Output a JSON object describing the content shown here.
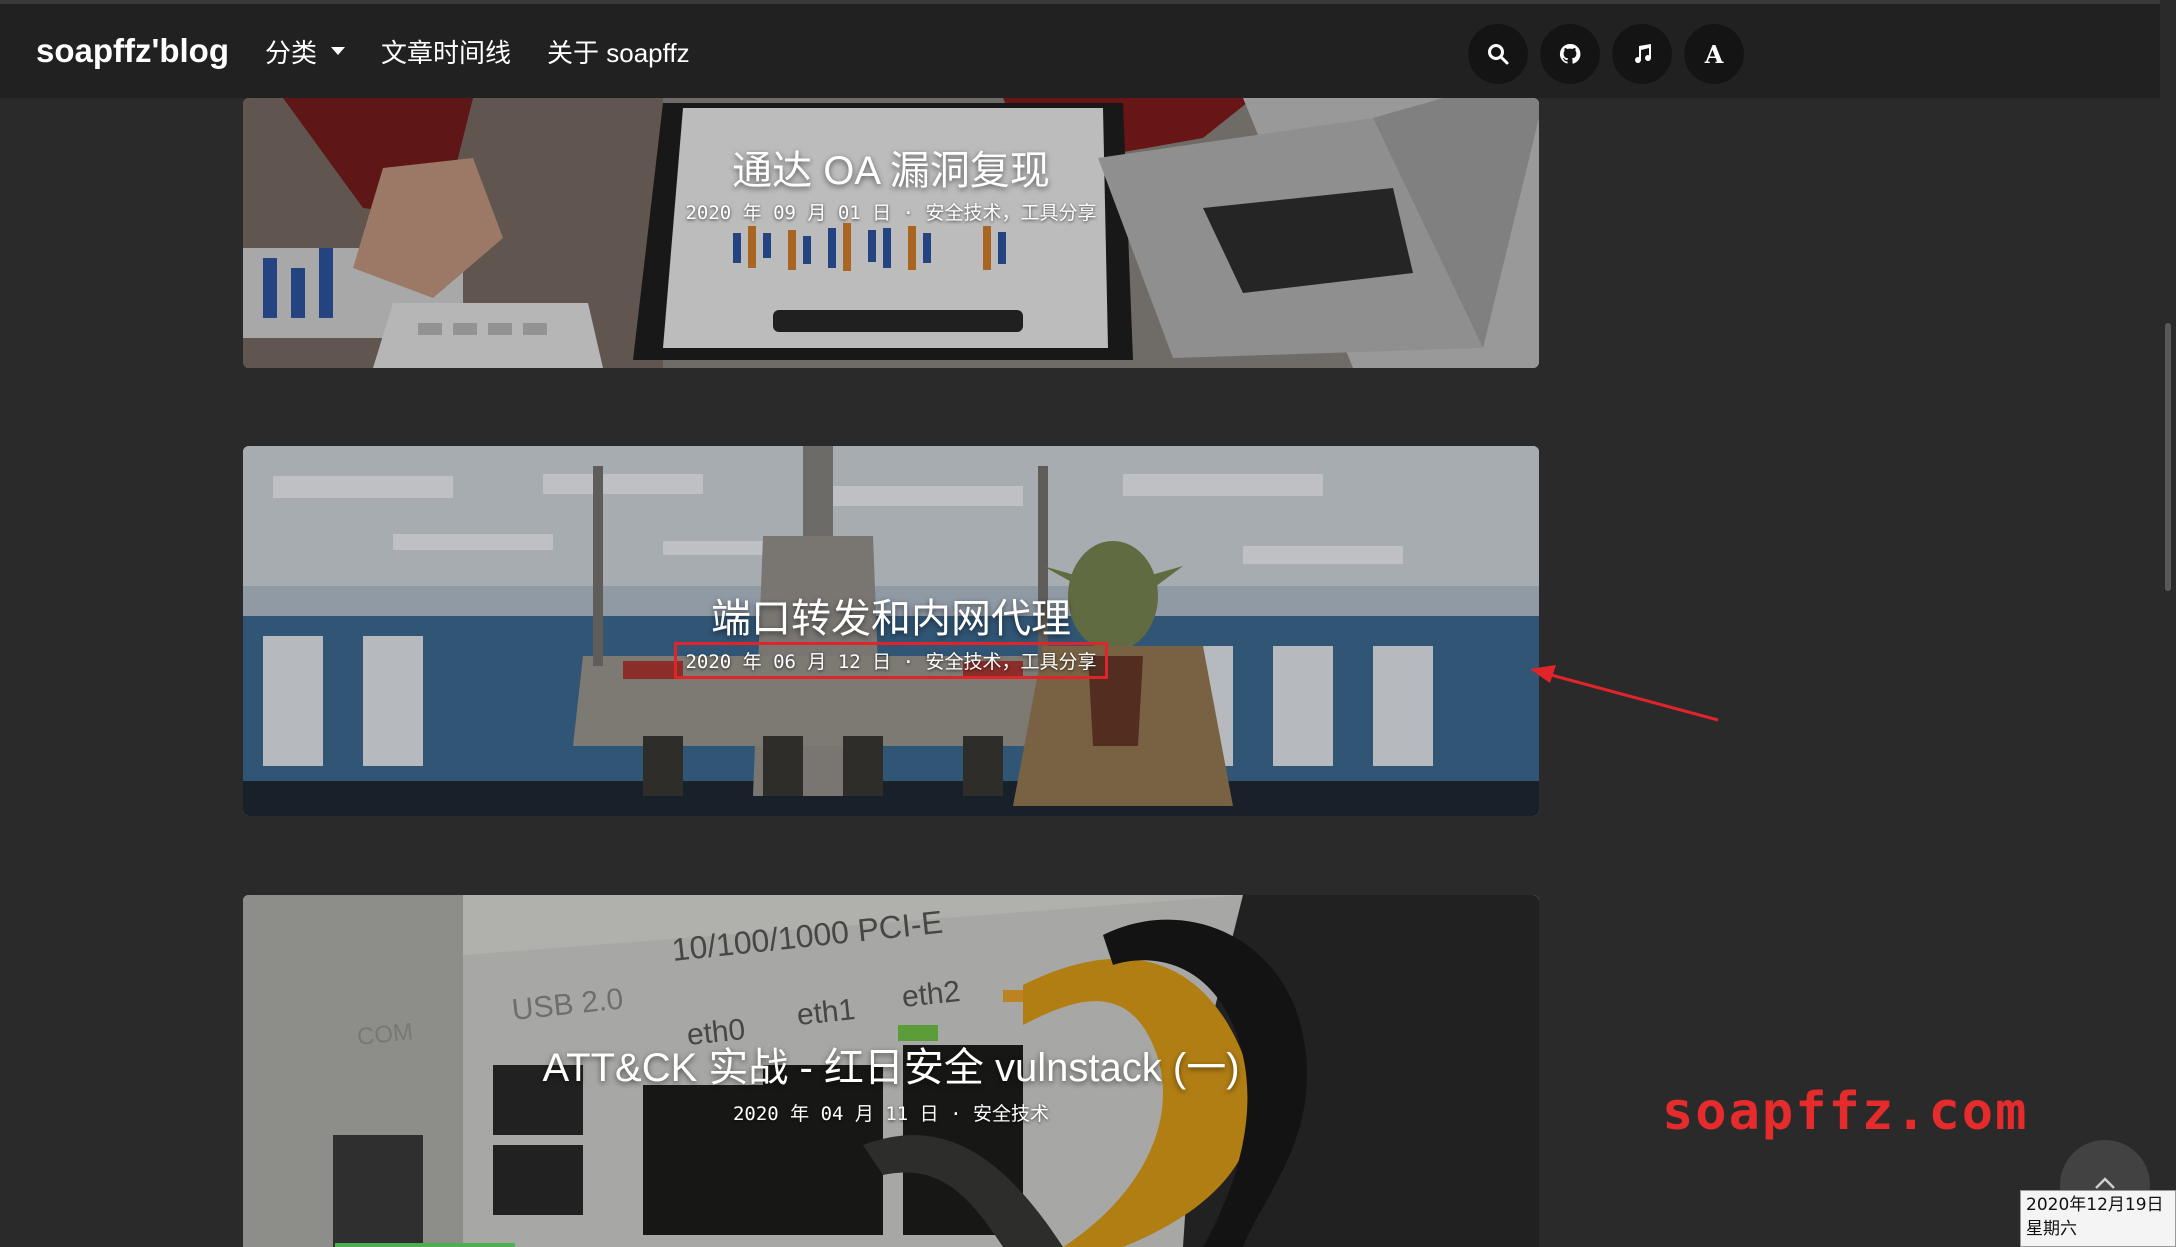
{
  "nav": {
    "brand": "soapffz'blog",
    "links": [
      {
        "label": "分类",
        "dropdown": true
      },
      {
        "label": "文章时间线"
      },
      {
        "label": "关于 soapffz"
      }
    ],
    "icons": [
      "search-icon",
      "github-icon",
      "music-icon",
      "font-icon"
    ],
    "font_icon_letter": "A"
  },
  "posts": [
    {
      "title": "通达 OA 漏洞复现",
      "date": "2020 年 09 月 01 日",
      "sep": "·",
      "tags": "安全技术，工具分享"
    },
    {
      "title": "端口转发和内网代理",
      "date": "2020 年 06 月 12 日",
      "sep": "·",
      "tags": "安全技术，工具分享",
      "highlighted": true
    },
    {
      "title": "ATT&CK 实战 - 红日安全 vulnstack (一)",
      "date": "2020 年 04 月 11 日",
      "sep": "·",
      "tags": "安全技术"
    }
  ],
  "scene_text": {
    "pci": "10/100/1000 PCI-E",
    "usb": "USB 2.0",
    "com": "COM",
    "eth0": "eth0",
    "eth1": "eth1",
    "eth2": "eth2"
  },
  "watermark": "soapffz.com",
  "clock": {
    "date": "2020年12月19日",
    "weekday": "星期六"
  },
  "colors": {
    "accent_red": "#e0242a",
    "navbar": "#222121",
    "background": "#2b2a2a"
  }
}
